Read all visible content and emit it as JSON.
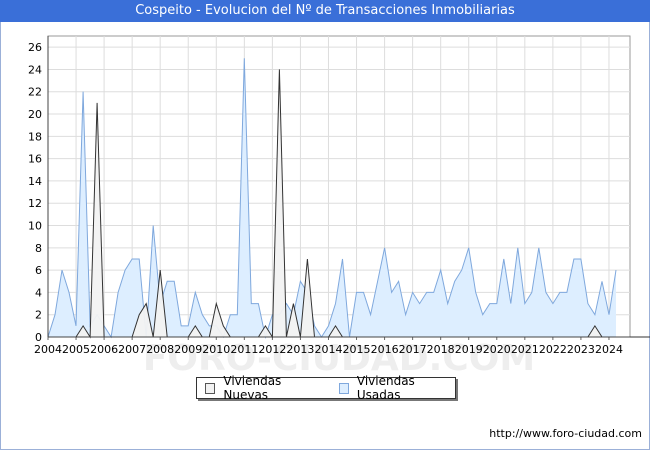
{
  "title": "Cospeito - Evolucion del Nº de Transacciones Inmobiliarias",
  "watermark": "FORO-CIUDAD.COM",
  "footer_url": "http://www.foro-ciudad.com",
  "colors": {
    "header_bg": "#3a6fd8",
    "nuevas_fill": "#f2f2f2",
    "nuevas_line": "#333333",
    "usadas_fill": "#ddeeff",
    "usadas_line": "#7fa8dd"
  },
  "chart_data": {
    "type": "area",
    "xlabel": "",
    "ylabel": "",
    "title": "Cospeito - Evolucion del Nº de Transacciones Inmobiliarias",
    "xlim": [
      2004,
      2024.75
    ],
    "ylim": [
      0,
      27
    ],
    "yticks": [
      0,
      2,
      4,
      6,
      8,
      10,
      12,
      14,
      16,
      18,
      20,
      22,
      24,
      26
    ],
    "xticks": [
      "2004",
      "2005",
      "2006",
      "2007",
      "2008",
      "2009",
      "2010",
      "2011",
      "2012",
      "2013",
      "2014",
      "2015",
      "2016",
      "2017",
      "2018",
      "2019",
      "2020",
      "2021",
      "2022",
      "2023",
      "2024"
    ],
    "grid": true,
    "legend_position": "bottom-center",
    "x_start": 2004,
    "x_step": 0.25,
    "series": [
      {
        "name": "Viviendas Nuevas",
        "values": [
          0,
          0,
          0,
          0,
          0,
          1,
          0,
          21,
          0,
          0,
          0,
          0,
          0,
          2,
          3,
          0,
          6,
          0,
          0,
          0,
          0,
          1,
          0,
          0,
          3,
          1,
          0,
          0,
          0,
          0,
          0,
          1,
          0,
          24,
          0,
          3,
          0,
          7,
          0,
          0,
          0,
          1,
          0,
          0,
          0,
          0,
          0,
          0,
          0,
          0,
          0,
          0,
          0,
          0,
          0,
          0,
          0,
          0,
          0,
          0,
          0,
          0,
          0,
          0,
          0,
          0,
          0,
          0,
          0,
          0,
          0,
          0,
          0,
          0,
          0,
          0,
          0,
          0,
          1,
          0,
          0,
          0,
          0,
          0,
          0,
          0,
          0,
          0,
          0,
          0,
          0,
          0,
          0,
          1,
          0,
          0,
          0,
          0,
          0,
          0,
          0,
          0,
          0,
          0,
          0,
          0,
          0,
          0,
          0,
          0,
          0,
          0,
          0,
          0,
          0,
          0,
          0,
          0,
          0,
          0,
          0,
          0,
          0,
          0,
          0,
          0,
          0,
          0,
          0,
          0,
          0,
          0,
          0,
          0,
          0,
          0,
          0,
          0,
          0,
          0,
          0,
          0,
          0,
          0,
          0,
          0,
          0,
          0
        ]
      },
      {
        "name": "Viviendas Usadas",
        "values": [
          0,
          2,
          6,
          4,
          1,
          22,
          1,
          2,
          1,
          0,
          4,
          6,
          7,
          7,
          0,
          10,
          3,
          5,
          5,
          1,
          1,
          4,
          2,
          1,
          1,
          0,
          2,
          2,
          25,
          3,
          3,
          0,
          2,
          2,
          3,
          2,
          5,
          4,
          1,
          0,
          1,
          3,
          7,
          0,
          4,
          4,
          2,
          5,
          8,
          4,
          5,
          2,
          4,
          3,
          4,
          4,
          6,
          3,
          5,
          6,
          8,
          4,
          2,
          3,
          3,
          7,
          3,
          8,
          3,
          4,
          8,
          4,
          3,
          4,
          4,
          7,
          7,
          3,
          2,
          5,
          2,
          6
        ]
      }
    ]
  }
}
